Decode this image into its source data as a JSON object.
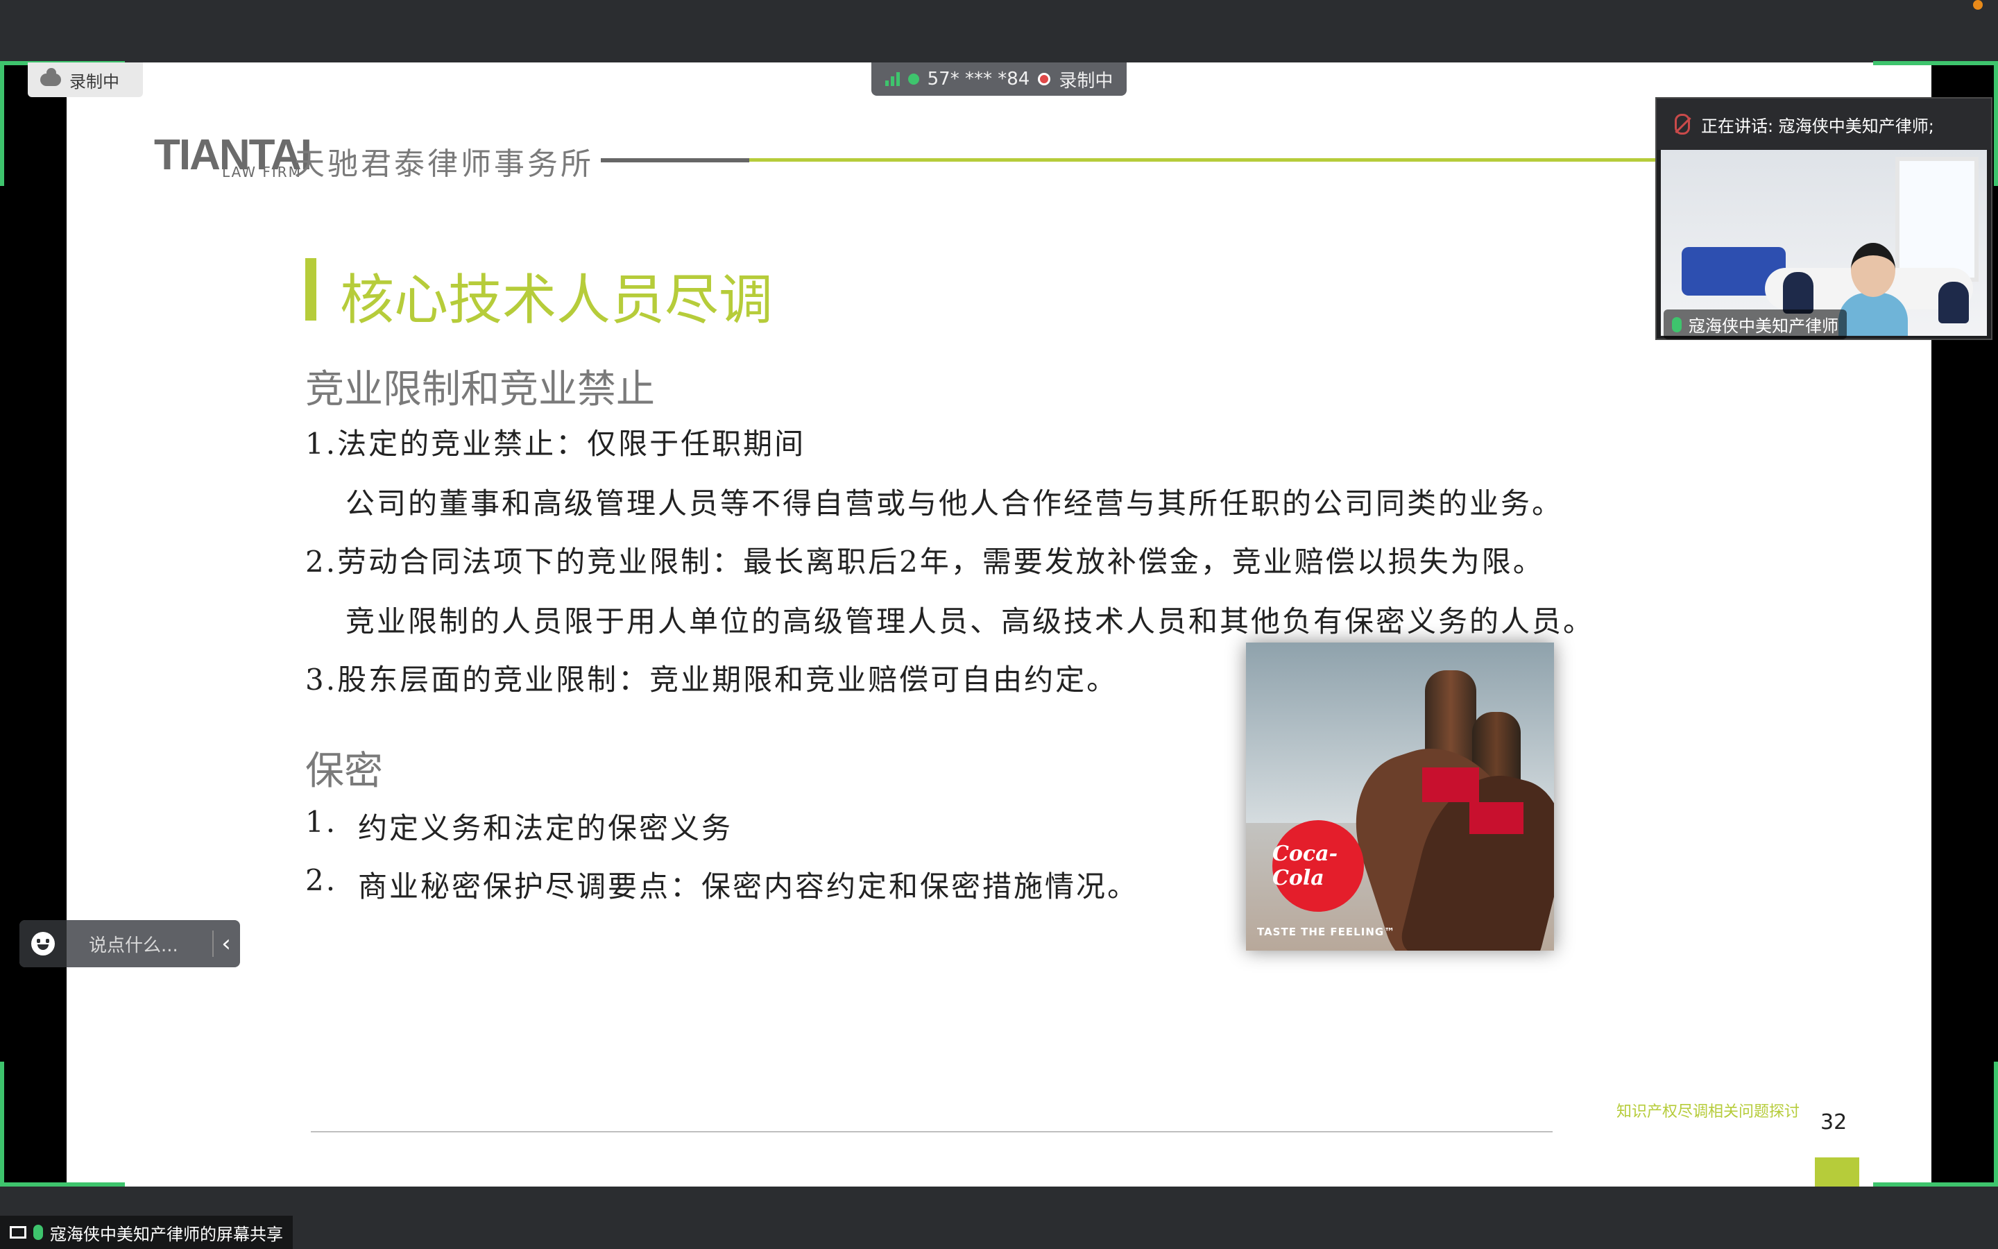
{
  "app": {
    "recording_badge": "录制中",
    "meeting_info": {
      "meeting_id": "57* *** *84",
      "recording": "录制中"
    },
    "share_label": "寇海侠中美知产律师的屏幕共享",
    "accent_color": "#3ec46d"
  },
  "video_tile": {
    "speaking": "正在讲话: 寇海侠中美知产律师;",
    "participant_name": "寇海侠中美知产律师",
    "mic_icon": "mic-muted-icon"
  },
  "chat": {
    "placeholder": "说点什么...",
    "emoji_icon": "smile-icon",
    "collapse_icon": "chevron-left-icon"
  },
  "slide": {
    "logo": {
      "main": "TIANTAI",
      "sub": "LAW FIRM",
      "cn": "天驰君泰律师事务所"
    },
    "title": "核心技术人员尽调",
    "section1": {
      "heading": "竞业限制和竞业禁止",
      "lines": [
        "1.法定的竞业禁止：仅限于任职期间",
        "公司的董事和高级管理人员等不得自营或与他人合作经营与其所任职的公司同类的业务。",
        "2.劳动合同法项下的竞业限制：最长离职后2年，需要发放补偿金，竞业赔偿以损失为限。",
        "竞业限制的人员限于用人单位的高级管理人员、高级技术人员和其他负有保密义务的人员。",
        "3.股东层面的竞业限制：竞业期限和竞业赔偿可自由约定。"
      ]
    },
    "section2": {
      "heading": "保密",
      "items": [
        {
          "num": "1.",
          "text": "约定义务和法定的保密义务"
        },
        {
          "num": "2.",
          "text": "商业秘密保护尽调要点：保密内容约定和保密措施情况。"
        }
      ]
    },
    "image": {
      "logo_text": "Coca-Cola",
      "tagline": "TASTE THE FEELING™"
    },
    "footer": {
      "text": "知识产权尽调相关问题探讨",
      "page_number": "32"
    },
    "colors": {
      "accent": "#b6cc3a",
      "text": "#222222",
      "heading": "#7a7a7a"
    }
  }
}
